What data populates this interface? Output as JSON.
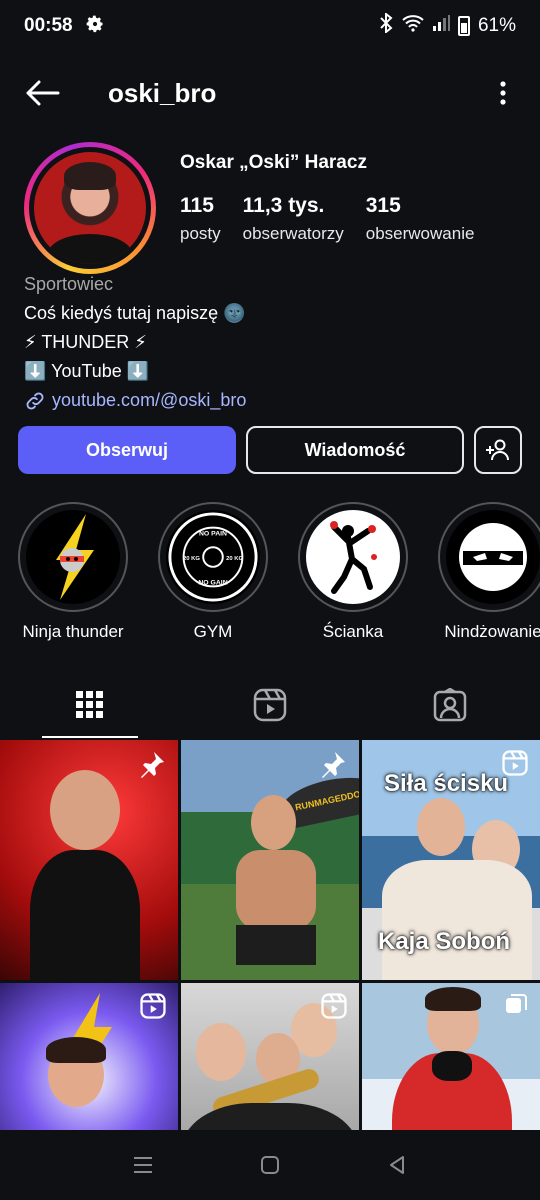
{
  "status_bar": {
    "time": "00:58",
    "battery": "61%"
  },
  "header": {
    "username": "oski_bro"
  },
  "profile": {
    "full_name": "Oskar „Oski” Haracz",
    "stats": [
      {
        "value": "115",
        "label": "posty"
      },
      {
        "value": "11,3 tys.",
        "label": "obserwatorzy"
      },
      {
        "value": "315",
        "label": "obserwowanie"
      }
    ],
    "category": "Sportowiec",
    "bio_lines": [
      "Coś kiedyś tutaj napiszę 🌚",
      "⚡ THUNDER ⚡",
      "⬇️   YouTube  ⬇️"
    ],
    "link": "youtube.com/@oski_bro"
  },
  "actions": {
    "follow": "Obserwuj",
    "message": "Wiadomość"
  },
  "highlights": [
    {
      "label": "Ninja thunder"
    },
    {
      "label": "GYM"
    },
    {
      "label": "Ścianka"
    },
    {
      "label": "Nindżowanie"
    }
  ],
  "gym_plate": {
    "top": "NO PAIN",
    "bottom": "NO GAIN",
    "left": "20 KG",
    "right": "20 KG"
  },
  "grid": {
    "tile3_top": "Siła ścisku",
    "tile3_bottom": "Kaja Soboń",
    "tile2_banner": "RUNMAGEDDON"
  },
  "colors": {
    "accent": "#5b5ef7",
    "link": "#a7b7ff",
    "background": "#0f1014"
  }
}
